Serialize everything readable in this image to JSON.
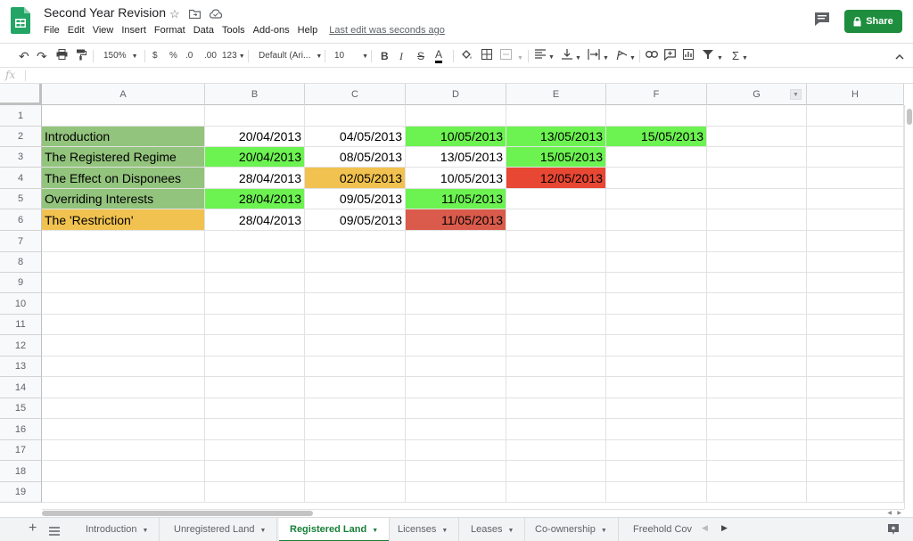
{
  "doc": {
    "title": "Second Year Revision",
    "menu": [
      "File",
      "Edit",
      "View",
      "Insert",
      "Format",
      "Data",
      "Tools",
      "Add-ons",
      "Help"
    ],
    "last_edit": "Last edit was seconds ago",
    "share_label": "Share"
  },
  "toolbar": {
    "zoom": "150%",
    "currency": "$",
    "percent": "%",
    "decrease_decimal": ".0",
    "increase_decimal": ".00",
    "more_formats": "123",
    "font": "Default (Ari...",
    "font_size": "10",
    "bold": "B",
    "italic": "I",
    "strike": "S",
    "text_color": "A",
    "functions": "Σ"
  },
  "formula_bar": {
    "fx": "fx",
    "value": ""
  },
  "columns": [
    "A",
    "B",
    "C",
    "D",
    "E",
    "F",
    "G",
    "H"
  ],
  "rows": [
    "1",
    "2",
    "3",
    "4",
    "5",
    "6",
    "7",
    "8",
    "9",
    "10",
    "11",
    "12",
    "13",
    "14",
    "15",
    "16",
    "17",
    "18",
    "19"
  ],
  "cells": {
    "r2": [
      "Introduction",
      "20/04/2013",
      "04/05/2013",
      "10/05/2013",
      "13/05/2013",
      "15/05/2013"
    ],
    "r3": [
      "The Registered Regime",
      "20/04/2013",
      "08/05/2013",
      "13/05/2013",
      "15/05/2013",
      ""
    ],
    "r4": [
      "The Effect on Disponees",
      "28/04/2013",
      "02/05/2013",
      "10/05/2013",
      "12/05/2013",
      ""
    ],
    "r5": [
      "Overriding Interests",
      "28/04/2013",
      "09/05/2013",
      "11/05/2013",
      "",
      ""
    ],
    "r6": [
      "The 'Restriction'",
      "28/04/2013",
      "09/05/2013",
      "11/05/2013",
      "",
      ""
    ]
  },
  "cell_colors": {
    "green_dark": "#93c47d",
    "green_bright": "#6cf251",
    "orange": "#f1c24f",
    "red": "#e84733",
    "red_muted": "#da5b4b"
  },
  "sheets": [
    "Introduction",
    "Unregistered Land",
    "Registered Land",
    "Licenses",
    "Leases",
    "Co-ownership",
    "Freehold Cov"
  ],
  "active_sheet": "Registered Land",
  "accent": "#188038"
}
